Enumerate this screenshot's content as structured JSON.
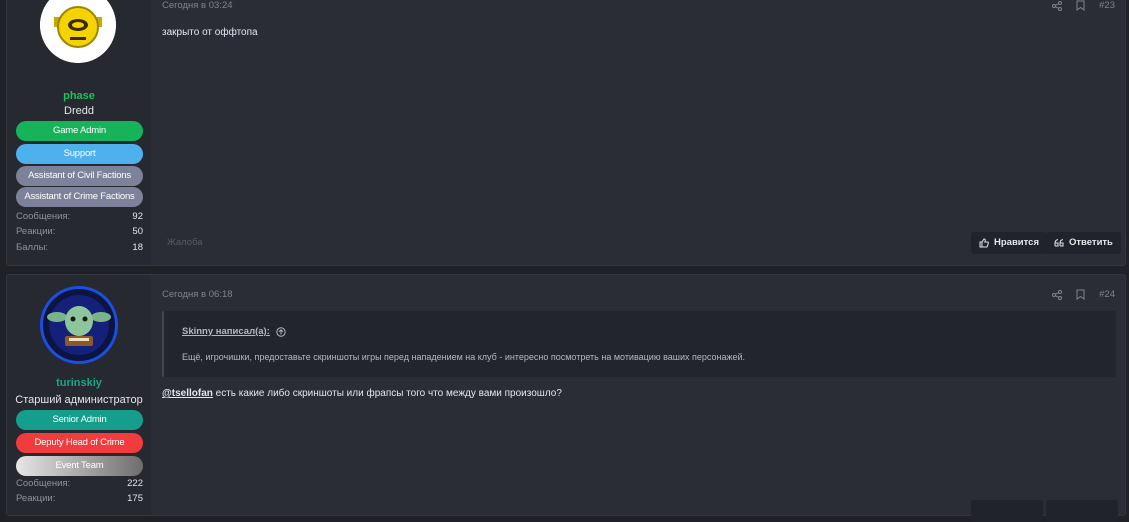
{
  "posts": [
    {
      "user": {
        "name": "phase",
        "name_color": "#1ec15b",
        "title": "Dredd",
        "badges": [
          {
            "label": "Game Admin",
            "color": "#16b35a"
          },
          {
            "label": "Support",
            "color": "#4fb0ee"
          },
          {
            "label": "Assistant of Civil Factions",
            "color": "#7c8299"
          },
          {
            "label": "Assistant of Crime Factions",
            "color": "#7c8299"
          }
        ],
        "stats": [
          {
            "label": "Сообщения:",
            "value": "92"
          },
          {
            "label": "Реакции:",
            "value": "50"
          },
          {
            "label": "Баллы:",
            "value": "18"
          }
        ]
      },
      "date": "Сегодня в 03:24",
      "number": "#23",
      "text": "закрыто от оффтопа",
      "report": "Жалоба",
      "like_label": "Нравится",
      "reply_label": "Ответить"
    },
    {
      "user": {
        "name": "turinskiy",
        "name_color": "#17a58b",
        "title": "Старший администратор",
        "badges": [
          {
            "label": "Senior Admin",
            "color": "#149e8b"
          },
          {
            "label": "Deputy Head of Crime",
            "color": "#f03c3c"
          },
          {
            "label": "Event Team",
            "color": "#9b9b9b"
          }
        ],
        "stats": [
          {
            "label": "Сообщения:",
            "value": "222"
          },
          {
            "label": "Реакции:",
            "value": "175"
          }
        ]
      },
      "date": "Сегодня в 06:18",
      "number": "#24",
      "quote": {
        "author": "Skinny написал(а):",
        "text": "Ещё, игрочишки, предоставьте скриншоты игры перед нападением на клуб - интересно посмотреть на мотивацию ваших персонажей."
      },
      "mention": "@tsellofan",
      "text": " есть какие либо скриншоты или фрапсы того что между вами произошло?"
    }
  ]
}
